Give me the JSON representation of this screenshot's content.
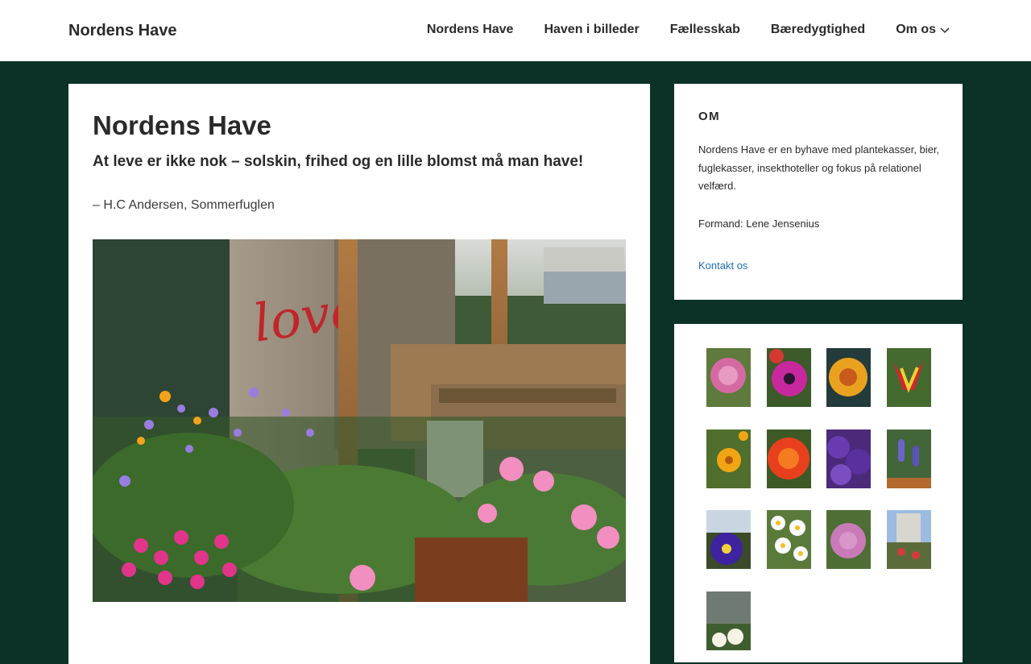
{
  "header": {
    "site_title": "Nordens Have",
    "nav": [
      {
        "label": "Nordens Have"
      },
      {
        "label": "Haven i billeder"
      },
      {
        "label": "Fællesskab"
      },
      {
        "label": "Bæredygtighed"
      },
      {
        "label": "Om os",
        "has_submenu": true
      }
    ]
  },
  "main": {
    "title": "Nordens Have",
    "quote": "At leve er ikke nok – solskin, frihed og en lille blomst må man have!",
    "attribution": "– H.C Andersen, Sommerfuglen",
    "hero_graffiti": "love"
  },
  "sidebar": {
    "about": {
      "heading": "OM",
      "text": "Nordens Have er en byhave med plantekasser, bier, fuglekasser, insekthoteller og fokus på relationel velfærd.",
      "chair": "Formand: Lene Jensenius",
      "contact_link": "Kontakt os"
    },
    "gallery_count": 13
  },
  "colors": {
    "background": "#0c3127",
    "surface": "#ffffff",
    "text": "#2a2a2a",
    "link": "#1f6fb5"
  }
}
